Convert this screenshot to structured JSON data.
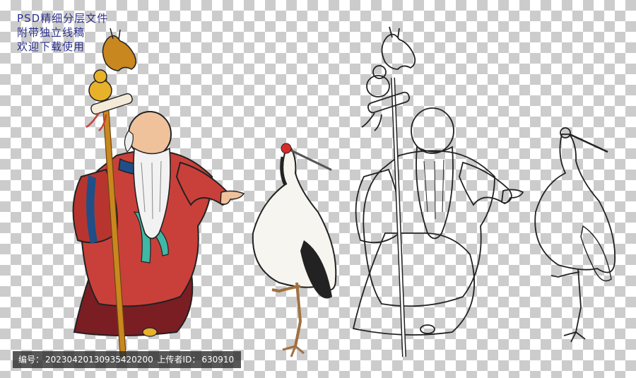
{
  "caption": {
    "line1": "PSD精细分层文件",
    "line2": "附带独立线稿",
    "line3": "欢迎下载使用"
  },
  "footer": {
    "id_label": "编号：",
    "id_value": "20230420130935420200",
    "uploader_label": "上传者ID：",
    "uploader_value": "630910"
  },
  "colors": {
    "robe": "#c9403a",
    "robe_dark": "#7a1e24",
    "trim": "#1f4f86",
    "sash": "#3fb8a6",
    "skin": "#f0c29b",
    "staff": "#c9871f",
    "gourd": "#e8b12a",
    "crane_crown": "#d62b2b",
    "crane_black": "#222222"
  },
  "icons": [
    "elder-figure-color",
    "crane-color",
    "elder-figure-lineart",
    "crane-lineart"
  ]
}
